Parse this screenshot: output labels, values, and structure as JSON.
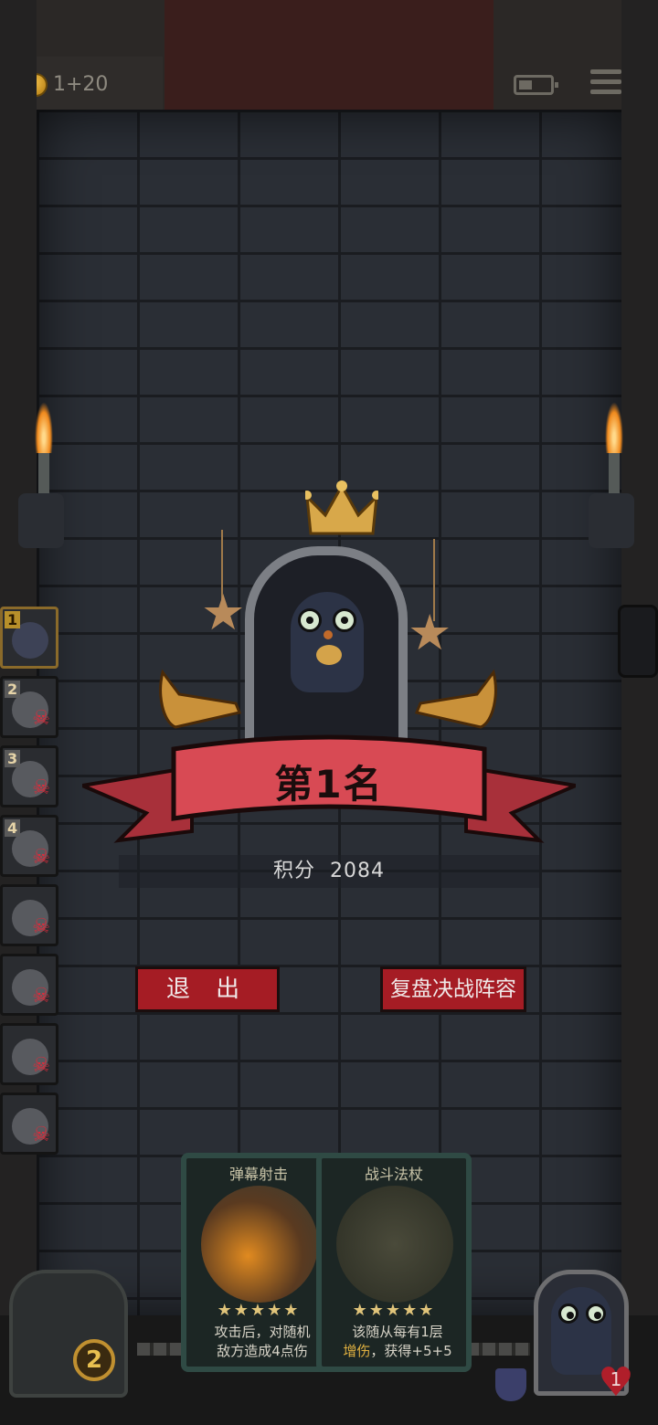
{
  "hud": {
    "coin_text": "1+20"
  },
  "result": {
    "rank_label": "第1名",
    "score_label": "积分",
    "score_value": "2084"
  },
  "buttons": {
    "exit_label": "退 出",
    "replay_label": "复盘决战阵容"
  },
  "roster": [
    {
      "rank": "1",
      "status": "alive"
    },
    {
      "rank": "2",
      "status": "eliminated"
    },
    {
      "rank": "3",
      "status": "eliminated"
    },
    {
      "rank": "4",
      "status": "eliminated"
    },
    {
      "rank": "",
      "status": "eliminated"
    },
    {
      "rank": "",
      "status": "eliminated"
    },
    {
      "rank": "",
      "status": "eliminated"
    },
    {
      "rank": "",
      "status": "eliminated"
    }
  ],
  "cards": [
    {
      "name": "弹幕射击",
      "stars": 5,
      "desc_line1": "攻击后，对随机",
      "desc_line2": "敌方造成4点伤"
    },
    {
      "name": "战斗法杖",
      "stars": 5,
      "desc_line1": "该随从每有1层",
      "desc_highlight": "增伤",
      "desc_line2_rest": "，获得+5+5"
    }
  ],
  "bottom": {
    "shop_level": "2",
    "hero_health": "1"
  },
  "colors": {
    "button_red": "#a51c24",
    "ribbon_red": "#d84a54",
    "skull_red": "#e02a3a",
    "gold": "#c09030"
  },
  "icons": [
    "coin-icon",
    "battery-icon",
    "menu-icon",
    "crown-icon",
    "skull-icon",
    "star-icon",
    "horn-icon",
    "shield-icon",
    "heart-icon"
  ]
}
